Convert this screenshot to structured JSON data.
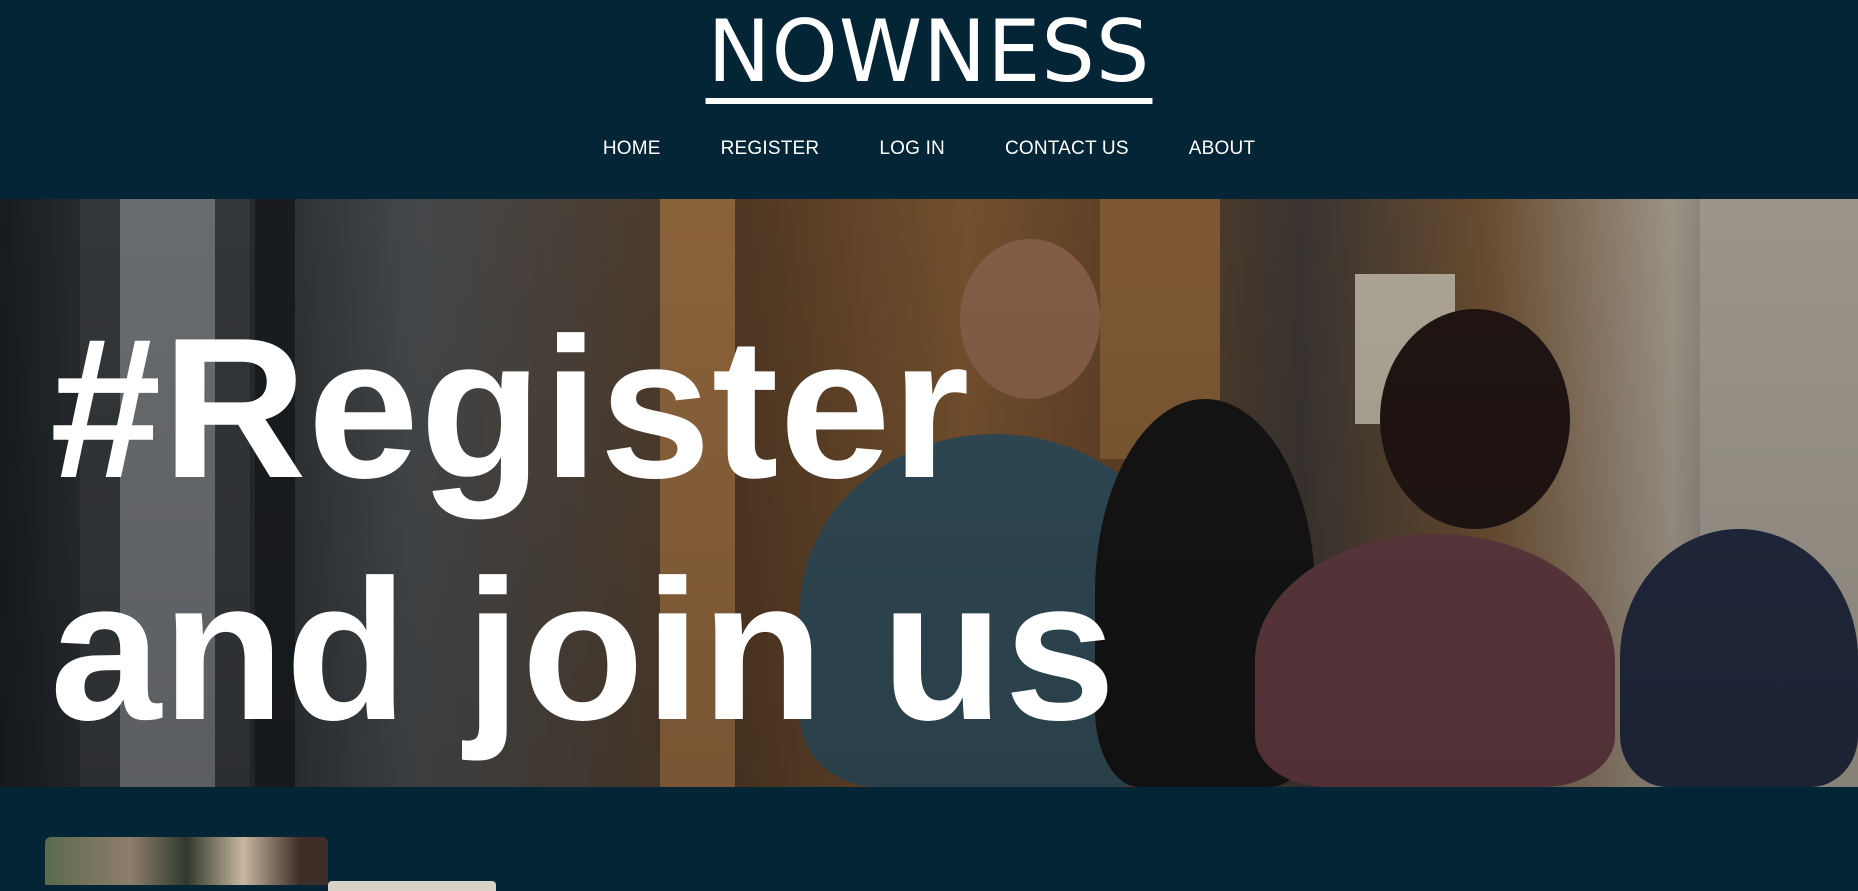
{
  "site": {
    "logo": "NOWNESS"
  },
  "nav": {
    "items": [
      {
        "label": "HOME"
      },
      {
        "label": "REGISTER"
      },
      {
        "label": "LOG IN"
      },
      {
        "label": "CONTACT US"
      },
      {
        "label": "ABOUT"
      }
    ]
  },
  "hero": {
    "line1": "#Register",
    "line2": "and join us"
  },
  "colors": {
    "header_bg": "#042535",
    "text": "#ffffff"
  }
}
